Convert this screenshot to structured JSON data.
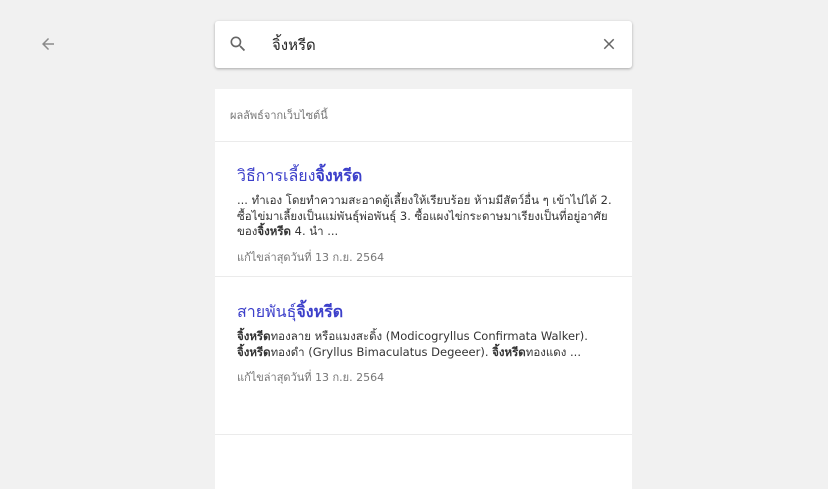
{
  "search": {
    "query": "จิ้งหรีด"
  },
  "results_header": "ผลลัพธ์จากเว็บไซต์นี้",
  "results": [
    {
      "title_pre": "วิธีการเลี้ยง",
      "title_bold": "จิ้งหรีด",
      "snippet_1": "... ทำเอง โดยทำความสะอาดตู้เลี้ยงให้เรียบร้อย ห้ามมีสัตว์อื่น ๆ เข้าไปได้ 2. ซื้อไข่มาเลี้ยงเป็นแม่พันธุ์พ่อพันธุ์ 3. ซื้อแผงไข่กระดาษมาเรียงเป็นที่อยู่อาศัยของ",
      "snippet_bold_1": "จิ้งหรีด",
      "snippet_2": " 4. นำ ...",
      "date": "แก้ไขล่าสุดวันที่ 13 ก.ย. 2564"
    },
    {
      "title_pre": "สายพันธุ์",
      "title_bold": "จิ้งหรีด",
      "snippet_bold_1": "จิ้งหรีด",
      "snippet_1": "ทองลาย หรือแมงสะดิ้ง (Modicogryllus Confirmata Walker). ",
      "snippet_bold_2": "จิ้งหรีด",
      "snippet_2": "ทองดำ (Gryllus Bimaculatus Degeeer). ",
      "snippet_bold_3": "จิ้งหรีด",
      "snippet_3": "ทองแดง ...",
      "date": "แก้ไขล่าสุดวันที่ 13 ก.ย. 2564"
    }
  ],
  "icons": {
    "back": "arrow-left",
    "search": "magnifier",
    "clear": "close-x"
  },
  "colors": {
    "link": "#3c3fca",
    "background": "#f1f1f1"
  }
}
